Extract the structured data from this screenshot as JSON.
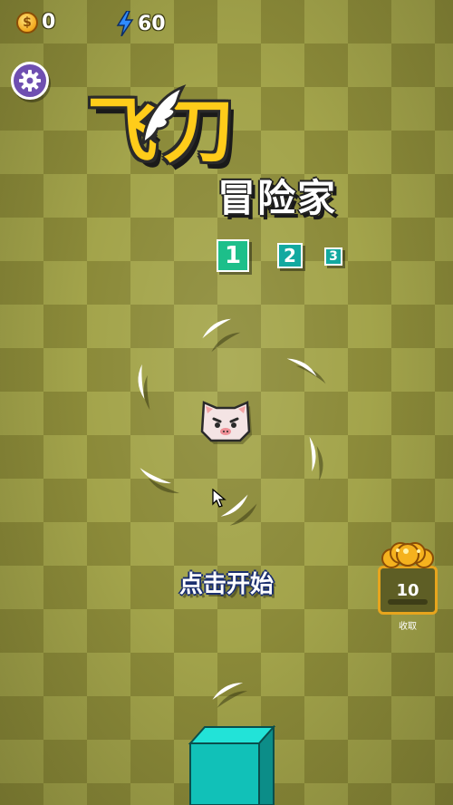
{
  "hud": {
    "coins": "0",
    "energy": "60",
    "coin_icon": "coin-icon",
    "energy_icon": "lightning-icon",
    "energy_color": "#2f8bff"
  },
  "settings": {
    "icon": "gear-icon",
    "bg_color": "#6f4fb1"
  },
  "logo": {
    "title": "飞刀",
    "subtitle": "冒险家",
    "title_color": "#ffcc1a"
  },
  "levels": [
    {
      "label": "1",
      "current": true
    },
    {
      "label": "2",
      "current": false
    },
    {
      "label": "3",
      "current": false
    }
  ],
  "game": {
    "player": "cat-face",
    "blade_count": 7,
    "start_prompt": "点击开始"
  },
  "reward": {
    "value": "10",
    "label": "收取",
    "icon": "coin-pile-icon"
  },
  "colors": {
    "board_dark": "#8b8a39",
    "board_light": "#a3a44b",
    "cube_top": "#22e3d8",
    "cube_side": "#0c8d88"
  }
}
